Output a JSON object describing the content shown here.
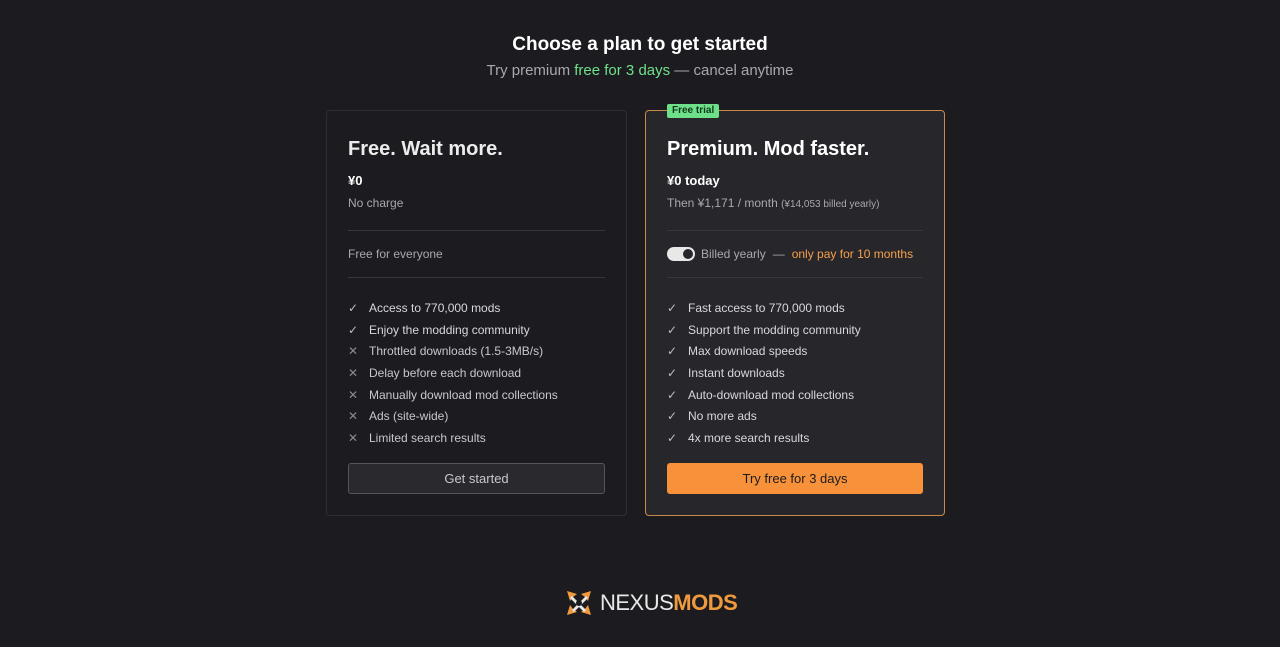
{
  "header": {
    "title": "Choose a plan to get started",
    "subtitle_prefix": "Try premium ",
    "subtitle_highlight": "free for 3 days",
    "subtitle_suffix": " — cancel anytime"
  },
  "free_plan": {
    "name": "Free. Wait more.",
    "price": "¥0",
    "price_note": "No charge",
    "tagline": "Free for everyone",
    "features": [
      {
        "text": "Access to 770,000 mods",
        "included": true
      },
      {
        "text": "Enjoy the modding community",
        "included": true
      },
      {
        "text": "Throttled downloads (1.5-3MB/s)",
        "included": false
      },
      {
        "text": "Delay before each download",
        "included": false
      },
      {
        "text": "Manually download mod collections",
        "included": false
      },
      {
        "text": "Ads (site-wide)",
        "included": false
      },
      {
        "text": "Limited search results",
        "included": false
      }
    ],
    "button_label": "Get started"
  },
  "premium_plan": {
    "badge": "Free trial",
    "name": "Premium. Mod faster.",
    "price": "¥0 today",
    "price_note": "Then ¥1,171 / month",
    "price_note_small": "(¥14,053 billed yearly)",
    "billing_toggle_on": true,
    "billing_label": "Billed yearly",
    "billing_dash": "—",
    "billing_offer": "only pay for 10 months",
    "features": [
      {
        "text": "Fast access to 770,000 mods",
        "included": true
      },
      {
        "text": "Support the modding community",
        "included": true
      },
      {
        "text": "Max download speeds",
        "included": true
      },
      {
        "text": "Instant downloads",
        "included": true
      },
      {
        "text": "Auto-download mod collections",
        "included": true
      },
      {
        "text": "No more ads",
        "included": true
      },
      {
        "text": "4x more search results",
        "included": true
      }
    ],
    "button_label": "Try free for 3 days"
  },
  "logo": {
    "text_light": "NEXUS",
    "text_accent": "MODS",
    "icon": "nexus-logo-icon"
  },
  "colors": {
    "background": "#1c1b1f",
    "accent_orange": "#f7923a",
    "accent_green": "#6fe08a"
  }
}
